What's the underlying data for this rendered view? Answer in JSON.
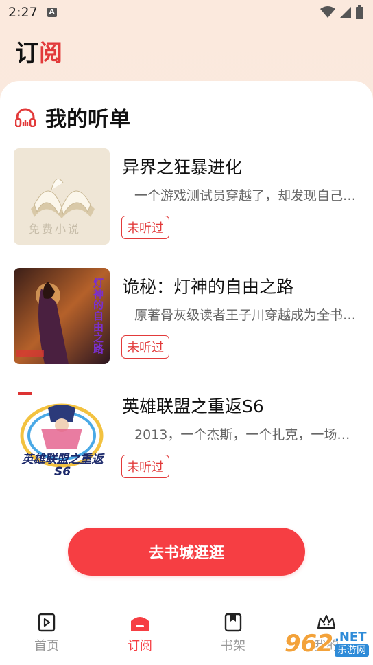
{
  "status_bar": {
    "time": "2:27",
    "app_icon_letter": "A"
  },
  "header": {
    "title_part1": "订",
    "title_part2": "阅"
  },
  "section": {
    "title": "我的听单",
    "icon": "headphones-icon"
  },
  "books": [
    {
      "title": "异界之狂暴进化",
      "description": "一个游戏测试员穿越了，却发现自己…",
      "status": "未听过",
      "cover_text": "免费小说"
    },
    {
      "title": "诡秘：灯神的自由之路",
      "description": "原著骨灰级读者王子川穿越成为全书…",
      "status": "未听过",
      "cover_text": "灯神的自由之路"
    },
    {
      "title": "英雄联盟之重返S6",
      "description": "2013，一个杰斯，一个扎克，一场…",
      "status": "未听过",
      "cover_text": "英雄联盟之重返S6"
    }
  ],
  "cta": {
    "label": "去书城逛逛"
  },
  "tabs": [
    {
      "label": "首页",
      "icon": "play-icon",
      "active": false
    },
    {
      "label": "订阅",
      "icon": "subscribe-icon",
      "active": true
    },
    {
      "label": "书架",
      "icon": "bookmark-icon",
      "active": false
    },
    {
      "label": "我的",
      "icon": "crown-icon",
      "active": false
    }
  ],
  "watermark": {
    "brand_number": "962",
    "brand_domain": ".NET",
    "brand_cn": "乐游网"
  },
  "colors": {
    "accent": "#f63e43",
    "badge": "#e23a3a",
    "watermark_orange": "#f3a23a",
    "watermark_blue": "#2e8bd8"
  }
}
